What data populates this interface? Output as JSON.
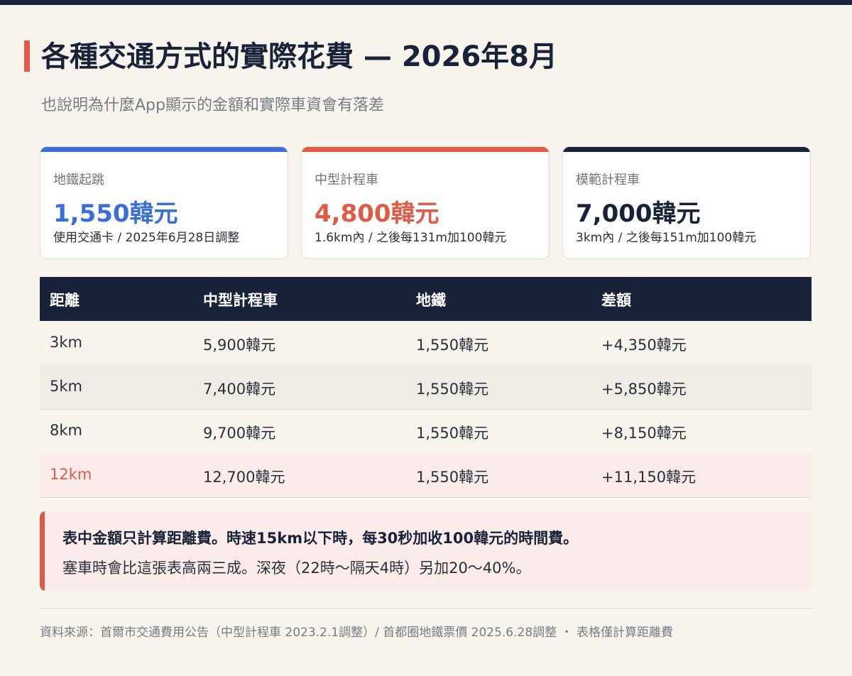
{
  "title": "各種交通方式的實際花費 — 2026年8月",
  "subtitle": "也說明為什麼App顯示的金額和實際車資會有落差",
  "cards": [
    {
      "label": "地鐵起跳",
      "value": "1,550韓元",
      "note": "使用交通卡 / 2025年6月28日調整",
      "accent": "#3a6fd8"
    },
    {
      "label": "中型計程車",
      "value": "4,800韓元",
      "note": "1.6km內 / 之後每131m加100韓元",
      "accent": "#e05a45"
    },
    {
      "label": "模範計程車",
      "value": "7,000韓元",
      "note": "3km內 / 之後每151m加100韓元",
      "accent": "#182238"
    }
  ],
  "table": {
    "headers": [
      "距離",
      "中型計程車",
      "地鐵",
      "差額"
    ],
    "rows": [
      [
        "3km",
        "5,900韓元",
        "1,550韓元",
        "+4,350韓元"
      ],
      [
        "5km",
        "7,400韓元",
        "1,550韓元",
        "+5,850韓元"
      ],
      [
        "8km",
        "9,700韓元",
        "1,550韓元",
        "+8,150韓元"
      ],
      [
        "12km",
        "12,700韓元",
        "1,550韓元",
        "+11,150韓元"
      ]
    ],
    "highlight_color": "#e05a45"
  },
  "note": {
    "line1": "表中金額只計算距離費。時速15km以下時，每30秒加收100韓元的時間費。",
    "line2": "塞車時會比這張表高兩三成。深夜（22時～隔天4時）另加20～40%。"
  },
  "footer": "資料來源：首爾市交通費用公告（中型計程車 2023.2.1調整）/ 首都圈地鐵票價 2025.6.28調整 ・ 表格僅計算距離費"
}
